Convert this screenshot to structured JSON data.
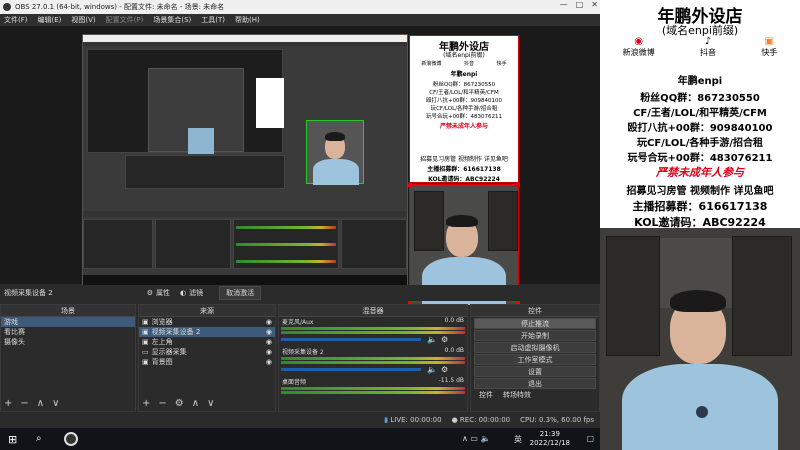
{
  "titlebar": {
    "text": "OBS 27.0.1 (64-bit, windows) - 配置文件: 未命名 - 场景: 未命名",
    "min": "—",
    "max": "□",
    "close": "✕"
  },
  "menu": [
    "文件(F)",
    "编辑(E)",
    "视图(V)",
    "配置文件(P)",
    "场景集合(S)",
    "工具(T)",
    "帮助(H)"
  ],
  "poster": {
    "title": "年鹏外设店",
    "subtitle": "(域名enpi前缀)",
    "platforms": [
      "新浪微博",
      "抖音",
      "快手"
    ],
    "brand": "年鹏enpi",
    "fans_qq": "粉丝QQ群：867230550",
    "games": "CF/王者/LOL/和平精英/CFM",
    "anti_cheat": "殴打八抗+00群：909840100",
    "helpers": "玩CF/LOL/各种手游/招合租",
    "account": "玩号合玩+00群：483076211",
    "minor": "严禁未成年人参与",
    "recruit": "招募见习房管 视频制作 详见鱼吧",
    "anchor": "主播招募群：616617138",
    "kol": "KOL邀请码：ABC92224"
  },
  "controls_bar": {
    "source_label": "视频采集设备 2",
    "properties": "属性",
    "filters": "滤镜",
    "deactivate": "取消激活"
  },
  "scenes": {
    "header": "场景",
    "items": [
      "游戏",
      "看比赛",
      "摄像头"
    ],
    "selected": 0
  },
  "sources": {
    "header": "来源",
    "items": [
      "浏览器",
      "视频采集设备 2",
      "左上角",
      "显示器采集",
      "背景图"
    ]
  },
  "mixer": {
    "header": "混音器",
    "channels": [
      {
        "name": "麦克风/Aux",
        "db": "0.0 dB"
      },
      {
        "name": "视频采集设备 2",
        "db": "0.0 dB"
      },
      {
        "name": "桌面音频",
        "db": "-11.5 dB"
      }
    ]
  },
  "controls": {
    "header": "控件",
    "buttons": [
      "停止推流",
      "开始录制",
      "启动虚拟摄像机",
      "工作室模式",
      "设置",
      "退出"
    ],
    "tabs": [
      "控件",
      "转场特效"
    ]
  },
  "status": {
    "live": "LIVE: 00:00:00",
    "rec": "REC: 00:00:00",
    "cpu": "CPU: 0.3%, 60.00 fps"
  },
  "taskbar": {
    "time": "21:39",
    "date": "2022/12/18",
    "lang": "英"
  },
  "colors": {
    "accent_red": "#e0001b",
    "selection": "#3d5a7a"
  }
}
